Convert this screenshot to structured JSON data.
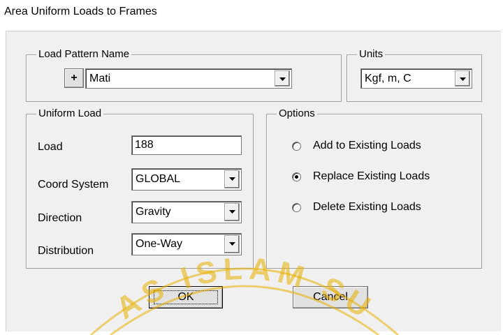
{
  "window": {
    "title": "Area Uniform Loads to Frames"
  },
  "load_pattern": {
    "group_label": "Load Pattern Name",
    "add_button": "+",
    "selected": "Mati"
  },
  "units": {
    "group_label": "Units",
    "selected": "Kgf, m, C"
  },
  "uniform_load": {
    "group_label": "Uniform Load",
    "load_label": "Load",
    "load_value": "188",
    "coord_label": "Coord System",
    "coord_value": "GLOBAL",
    "direction_label": "Direction",
    "direction_value": "Gravity",
    "distribution_label": "Distribution",
    "distribution_value": "One-Way"
  },
  "options": {
    "group_label": "Options",
    "items": [
      {
        "label": "Add to Existing Loads",
        "checked": false
      },
      {
        "label": "Replace Existing Loads",
        "checked": true
      },
      {
        "label": "Delete Existing Loads",
        "checked": false
      }
    ]
  },
  "buttons": {
    "ok": "OK",
    "cancel": "Cancel"
  },
  "watermark": {
    "text": "AS ISLAM SU",
    "color": "#e8b000"
  }
}
